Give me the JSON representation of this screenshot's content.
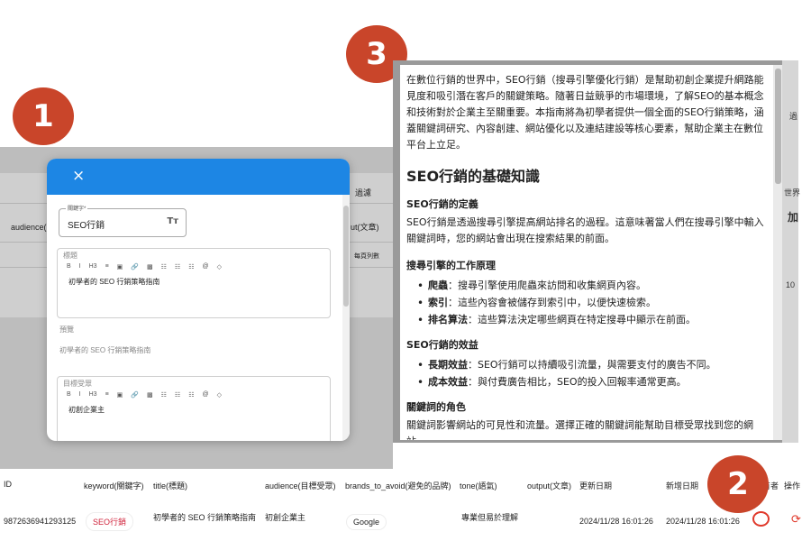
{
  "badges": [
    "1",
    "2",
    "3"
  ],
  "bg_screen": {
    "audience_label": "audience(",
    "filter_label": "過濾",
    "output_label": "ut(文章)",
    "per_page_label": "每頁列數"
  },
  "modal": {
    "close_symbol": "×",
    "keyword_field": {
      "label": "關鍵字*",
      "value": "SEO行銷",
      "icon": "text-format-icon",
      "icon_glyph": "Tт"
    },
    "title_editor": {
      "label": "標題",
      "content": "初學者的 SEO 行銷策略指南"
    },
    "preview": {
      "label": "預覽",
      "content": "初學者的 SEO 行銷策略指南"
    },
    "audience_editor": {
      "label": "目標受眾",
      "content": "初創企業主"
    },
    "toolbar": [
      "B",
      "I",
      "H3",
      "≡",
      "▣",
      "🔗",
      "▩",
      "☷",
      "☷",
      "☷",
      "@",
      "◇"
    ]
  },
  "article": {
    "intro": "在數位行銷的世界中，SEO行銷（搜尋引擎優化行銷）是幫助初創企業提升網路能見度和吸引潛在客戶的關鍵策略。隨著日益競爭的市場環境，了解SEO的基本概念和技術對於企業主至關重要。本指南將為初學者提供一個全面的SEO行銷策略，涵蓋關鍵詞研究、內容創建、網站優化以及連結建設等核心要素，幫助企業主在數位平台上立足。",
    "h2": "SEO行銷的基礎知識",
    "sec1_title": "SEO行銷的定義",
    "sec1_text": "SEO行銷是透過搜尋引擎提高網站排名的過程。這意味著當人們在搜尋引擎中輸入關鍵詞時，您的網站會出現在搜索結果的前面。",
    "sec2_title": "搜尋引擎的工作原理",
    "sec2_items": [
      {
        "term": "爬蟲",
        "text": "：搜尋引擎使用爬蟲來訪問和收集網頁內容。"
      },
      {
        "term": "索引",
        "text": "：這些內容會被儲存到索引中，以便快速檢索。"
      },
      {
        "term": "排名算法",
        "text": "：這些算法決定哪些網頁在特定搜尋中顯示在前面。"
      }
    ],
    "sec3_title": "SEO行銷的效益",
    "sec3_items": [
      {
        "term": "長期效益",
        "text": "：SEO行銷可以持續吸引流量，與需要支付的廣告不同。"
      },
      {
        "term": "成本效益",
        "text": "：與付費廣告相比，SEO的投入回報率通常更高。"
      }
    ],
    "sec4_title": "關鍵詞的角色",
    "sec4_text": "關鍵詞影響網站的可見性和流量。選擇正確的關鍵詞能幫助目標受眾找到您的網站。"
  },
  "edge_fragments": [
    "過",
    "世界",
    "加",
    "10"
  ],
  "table": {
    "headers": {
      "id": "ID",
      "keyword": "keyword(關鍵字)",
      "title": "title(標題)",
      "audience": "audience(目標受眾)",
      "brands": "brands_to_avoid(避免的品牌)",
      "tone": "tone(語氣)",
      "output": "output(文章)",
      "updated": "更新日期",
      "created": "新增日期",
      "author": "有者",
      "action": "操作"
    },
    "row": {
      "id": "9872636941293125",
      "keyword": "SEO行銷",
      "title": "初學者的 SEO 行銷策略指南",
      "audience": "初創企業主",
      "brand": "Google",
      "tone": "專業但易於理解",
      "updated": "2024/11/28 16:01:26",
      "created": "2024/11/28 16:01:26",
      "refresh_glyph": "⟳"
    }
  },
  "colors": {
    "modal_header": "#1d86e4",
    "badge": "#c9452a",
    "accent_red": "#e0392b"
  }
}
